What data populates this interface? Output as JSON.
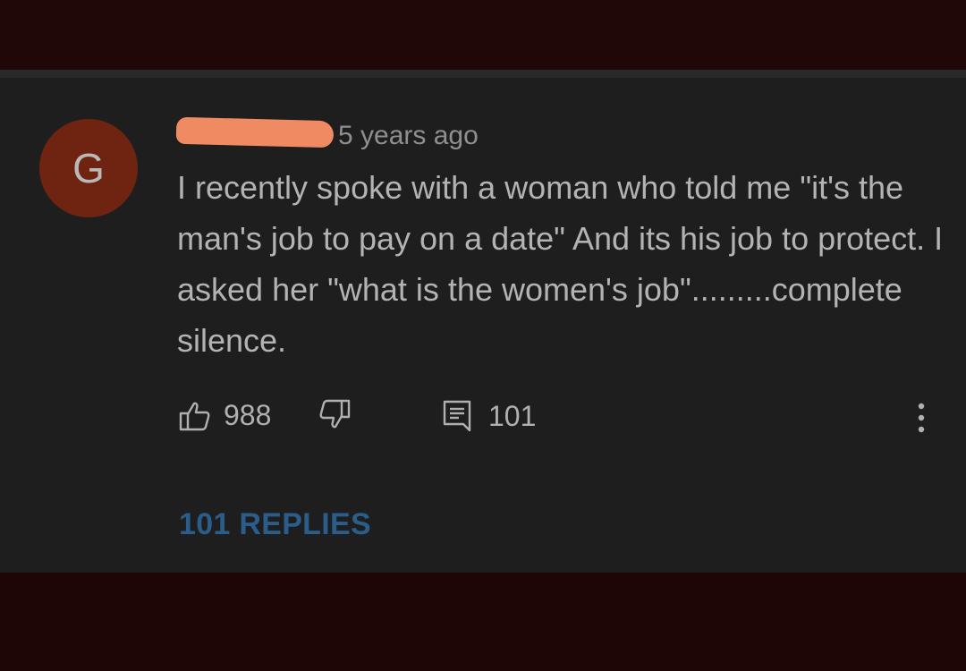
{
  "comment": {
    "avatar_letter": "G",
    "timestamp": "5 years ago",
    "text": "I recently spoke with a woman who told me \"it's the man's job to pay on a date\" And its his job to protect. I asked her \"what is the women's job\".........complete silence.",
    "likes": "988",
    "reply_count": "101",
    "replies_link": "101 REPLIES"
  },
  "colors": {
    "avatar_bg": "#6e2410",
    "redaction": "#f08a63",
    "replies_link": "#2a5d8a",
    "card_bg": "#1e1e1e"
  },
  "icons": [
    "thumbs-up-icon",
    "thumbs-down-icon",
    "comment-icon",
    "more-vert-icon"
  ]
}
